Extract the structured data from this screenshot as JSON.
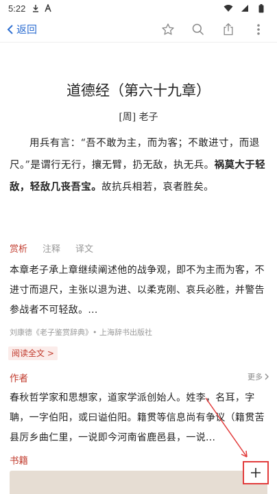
{
  "status_bar": {
    "time": "5:22",
    "icons": [
      "download-icon",
      "notification-a-icon",
      "wifi-icon",
      "signal-icon",
      "battery-icon"
    ]
  },
  "nav": {
    "back_label": "返回",
    "actions": [
      "star-icon",
      "search-icon",
      "share-icon",
      "more-vert-icon"
    ],
    "accent": "#2d6ed1"
  },
  "article": {
    "title": "道德经（第六十九章）",
    "author": "[周] 老子",
    "poem_parts": [
      {
        "text": "用兵有言：“吾不敢为主，而为客；不敢进寸，而退尺。”是谓行无行，攘无臂，扔无敌，执无兵。",
        "bold": false
      },
      {
        "text": "祸莫大于轻敌，轻敌几丧吾宝。",
        "bold": true
      },
      {
        "text": "故抗兵相若，哀者胜矣。",
        "bold": false
      }
    ]
  },
  "tabs": [
    {
      "label": "赏析",
      "active": true
    },
    {
      "label": "注释",
      "active": false
    },
    {
      "label": "译文",
      "active": false
    }
  ],
  "appreciation": {
    "text": "本章老子承上章继续阐述他的战争观，即不为主而为客，不进寸而退尺，主张以退为进、以柔克刚、哀兵必胜，并警告参战者不可轻敌。...",
    "source": "刘康德《老子鉴赏辞典》• 上海辞书出版社",
    "read_all": "阅读全文 >"
  },
  "author_section": {
    "label": "作者",
    "more": "更多",
    "bio": "春秋哲学家和思想家，道家学派创始人。姓李，名耳，字聃，一字伯阳，或曰谥伯阳。籍贯等信息尚有争议（籍贯苦县厉乡曲仁里，一说即今河南省鹿邑县，一说..."
  },
  "books_section": {
    "label": "书籍"
  },
  "colors": {
    "accent_red": "#c0392b",
    "highlight_red": "#e23a3a"
  }
}
